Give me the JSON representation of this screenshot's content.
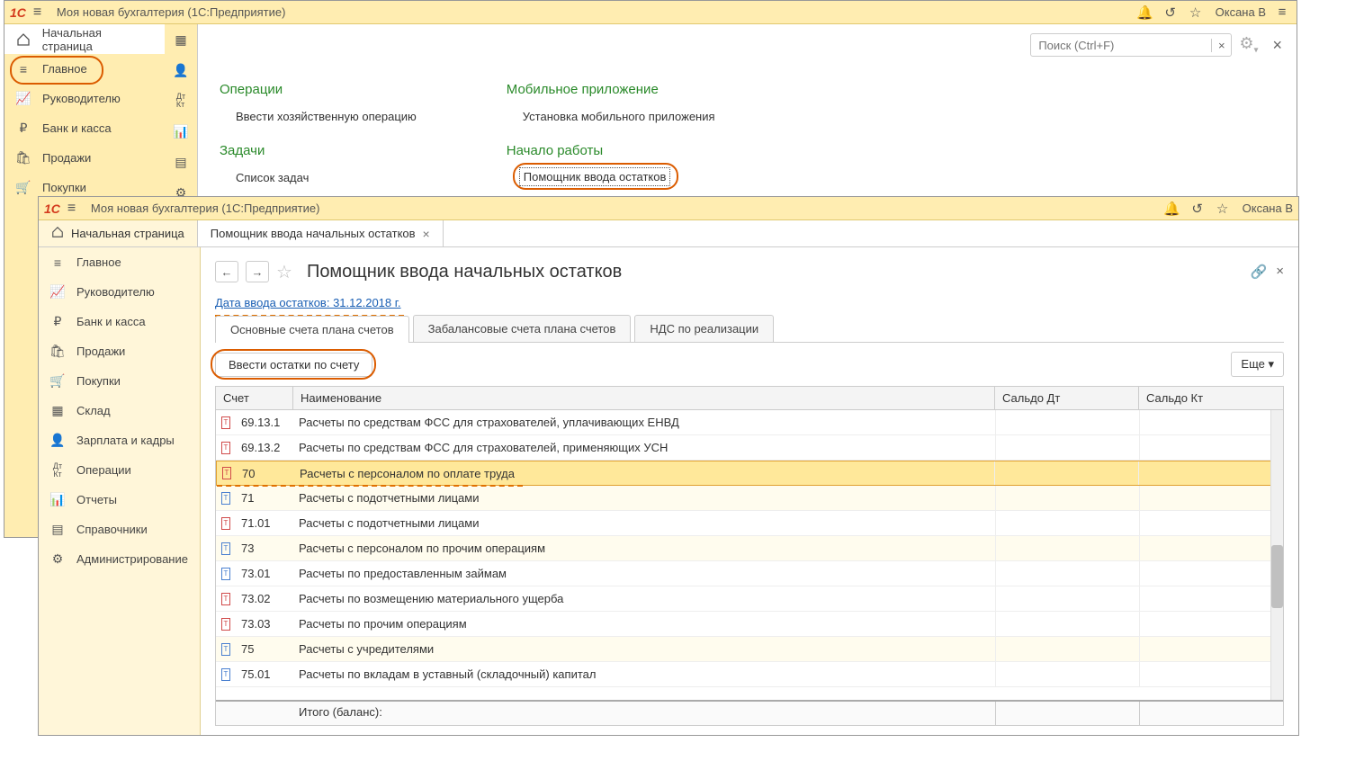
{
  "titlebar": {
    "app_title": "Моя новая бухгалтерия  (1С:Предприятие)",
    "user": "Оксана В"
  },
  "search": {
    "placeholder": "Поиск (Ctrl+F)"
  },
  "sidebar1": {
    "home": "Начальная страница",
    "items": [
      "Главное",
      "Руководителю",
      "Банк и касса",
      "Продажи",
      "Покупки"
    ]
  },
  "sections": {
    "c1": {
      "h1": "Операции",
      "l1": "Ввести хозяйственную операцию",
      "h2": "Задачи",
      "l2": "Список задач"
    },
    "c2": {
      "h1": "Мобильное приложение",
      "l1": "Установка мобильного приложения",
      "h2": "Начало работы",
      "l2": "Помощник ввода остатков"
    }
  },
  "win2_tabs": {
    "home": "Начальная страница",
    "t1": "Помощник ввода начальных остатков"
  },
  "sidebar2": [
    "Главное",
    "Руководителю",
    "Банк и касса",
    "Продажи",
    "Покупки",
    "Склад",
    "Зарплата и кадры",
    "Операции",
    "Отчеты",
    "Справочники",
    "Администрирование"
  ],
  "page": {
    "title": "Помощник ввода начальных остатков",
    "date_link": "Дата ввода остатков: 31.12.2018 г.",
    "tabs": [
      "Основные счета плана счетов",
      "Забалансовые счета плана счетов",
      "НДС по реализации"
    ],
    "btn_enter": "Ввести остатки по счету",
    "btn_more": "Еще ▾"
  },
  "grid": {
    "head": {
      "acc": "Счет",
      "name": "Наименование",
      "dt": "Сальдо Дт",
      "kt": "Сальдо Кт"
    },
    "rows": [
      {
        "ico": "red",
        "shade": false,
        "acc": "69.13.1",
        "name": "Расчеты по средствам ФСС для страхователей, уплачивающих ЕНВД"
      },
      {
        "ico": "red",
        "shade": false,
        "acc": "69.13.2",
        "name": "Расчеты по средствам ФСС для страхователей, применяющих УСН"
      },
      {
        "ico": "red",
        "shade": true,
        "sel": true,
        "acc": "70",
        "name": "Расчеты с персоналом по оплате труда"
      },
      {
        "ico": "blue",
        "shade": true,
        "acc": "71",
        "name": "Расчеты с подотчетными лицами"
      },
      {
        "ico": "red",
        "shade": false,
        "acc": "71.01",
        "name": "Расчеты с подотчетными лицами"
      },
      {
        "ico": "blue",
        "shade": true,
        "acc": "73",
        "name": "Расчеты с персоналом по прочим операциям"
      },
      {
        "ico": "blue",
        "shade": false,
        "acc": "73.01",
        "name": "Расчеты по предоставленным займам"
      },
      {
        "ico": "red",
        "shade": false,
        "acc": "73.02",
        "name": "Расчеты по возмещению материального ущерба"
      },
      {
        "ico": "red",
        "shade": false,
        "acc": "73.03",
        "name": "Расчеты по прочим операциям"
      },
      {
        "ico": "blue",
        "shade": true,
        "acc": "75",
        "name": "Расчеты с учредителями"
      },
      {
        "ico": "blue",
        "shade": false,
        "acc": "75.01",
        "name": "Расчеты по вкладам в уставный (складочный) капитал"
      }
    ],
    "footer": "Итого (баланс):"
  }
}
